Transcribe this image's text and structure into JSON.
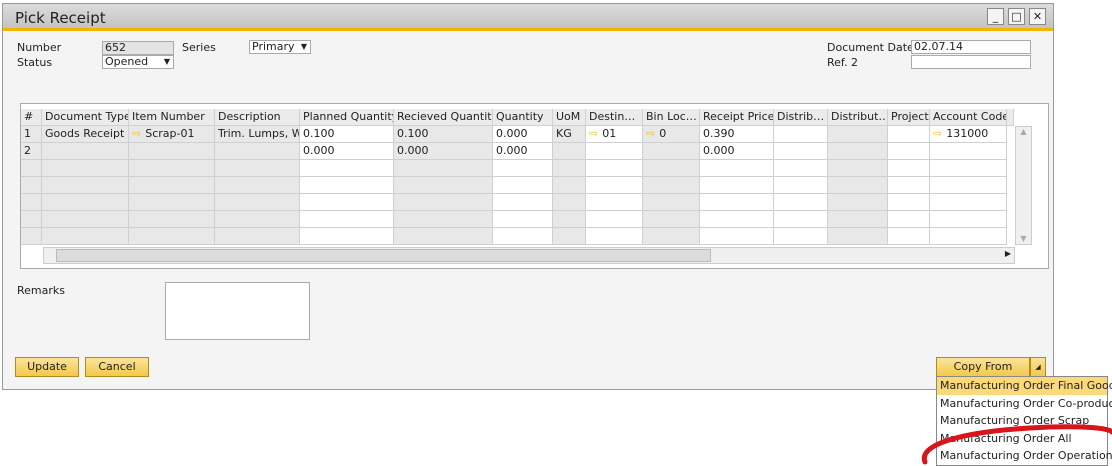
{
  "window": {
    "title": "Pick Receipt"
  },
  "header": {
    "number_label": "Number",
    "number_value": "652",
    "series_label": "Series",
    "series_value": "Primary",
    "status_label": "Status",
    "status_value": "Opened",
    "doc_date_label": "Document Date",
    "doc_date_value": "02.07.14",
    "ref2_label": "Ref. 2",
    "ref2_value": ""
  },
  "grid": {
    "columns": [
      "#",
      "Document Type",
      "Item Number",
      "Description",
      "Planned Quantity",
      "Recieved Quantity",
      "Quantity",
      "UoM",
      "Destin…",
      "Bin Loc…",
      "Receipt Price",
      "Distrib…",
      "Distribut…",
      "Project",
      "Account Code"
    ],
    "rows": [
      [
        "1",
        "Goods Receipt",
        "Scrap-01",
        "Trim. Lumps, Wet",
        "0.100",
        "0.100",
        "0.000",
        "KG",
        "01",
        "0",
        "0.390",
        "",
        "",
        "",
        "131000"
      ],
      [
        "2",
        "",
        "",
        "",
        "0.000",
        "0.000",
        "0.000",
        "",
        "",
        "",
        "0.000",
        "",
        "",
        "",
        ""
      ]
    ]
  },
  "remarks_label": "Remarks",
  "buttons": {
    "update": "Update",
    "cancel": "Cancel",
    "copy_from": "Copy From"
  },
  "copy_menu": [
    "Manufacturing Order Final Good",
    "Manufacturing Order Co-products",
    "Manufacturing Order Scrap",
    "Manufacturing Order All",
    "Manufacturing Order  Operations"
  ]
}
